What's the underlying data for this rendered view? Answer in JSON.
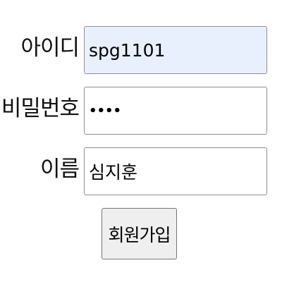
{
  "form": {
    "id_label": "아이디",
    "id_value": "spg1101",
    "password_label": "비밀번호",
    "password_value": "••••",
    "name_label": "이름",
    "name_value": "심지훈",
    "submit_label": "회원가입"
  },
  "colors": {
    "autofill_background": "#e8f0fe",
    "button_background": "#efefef",
    "border": "#8f8f8f"
  }
}
